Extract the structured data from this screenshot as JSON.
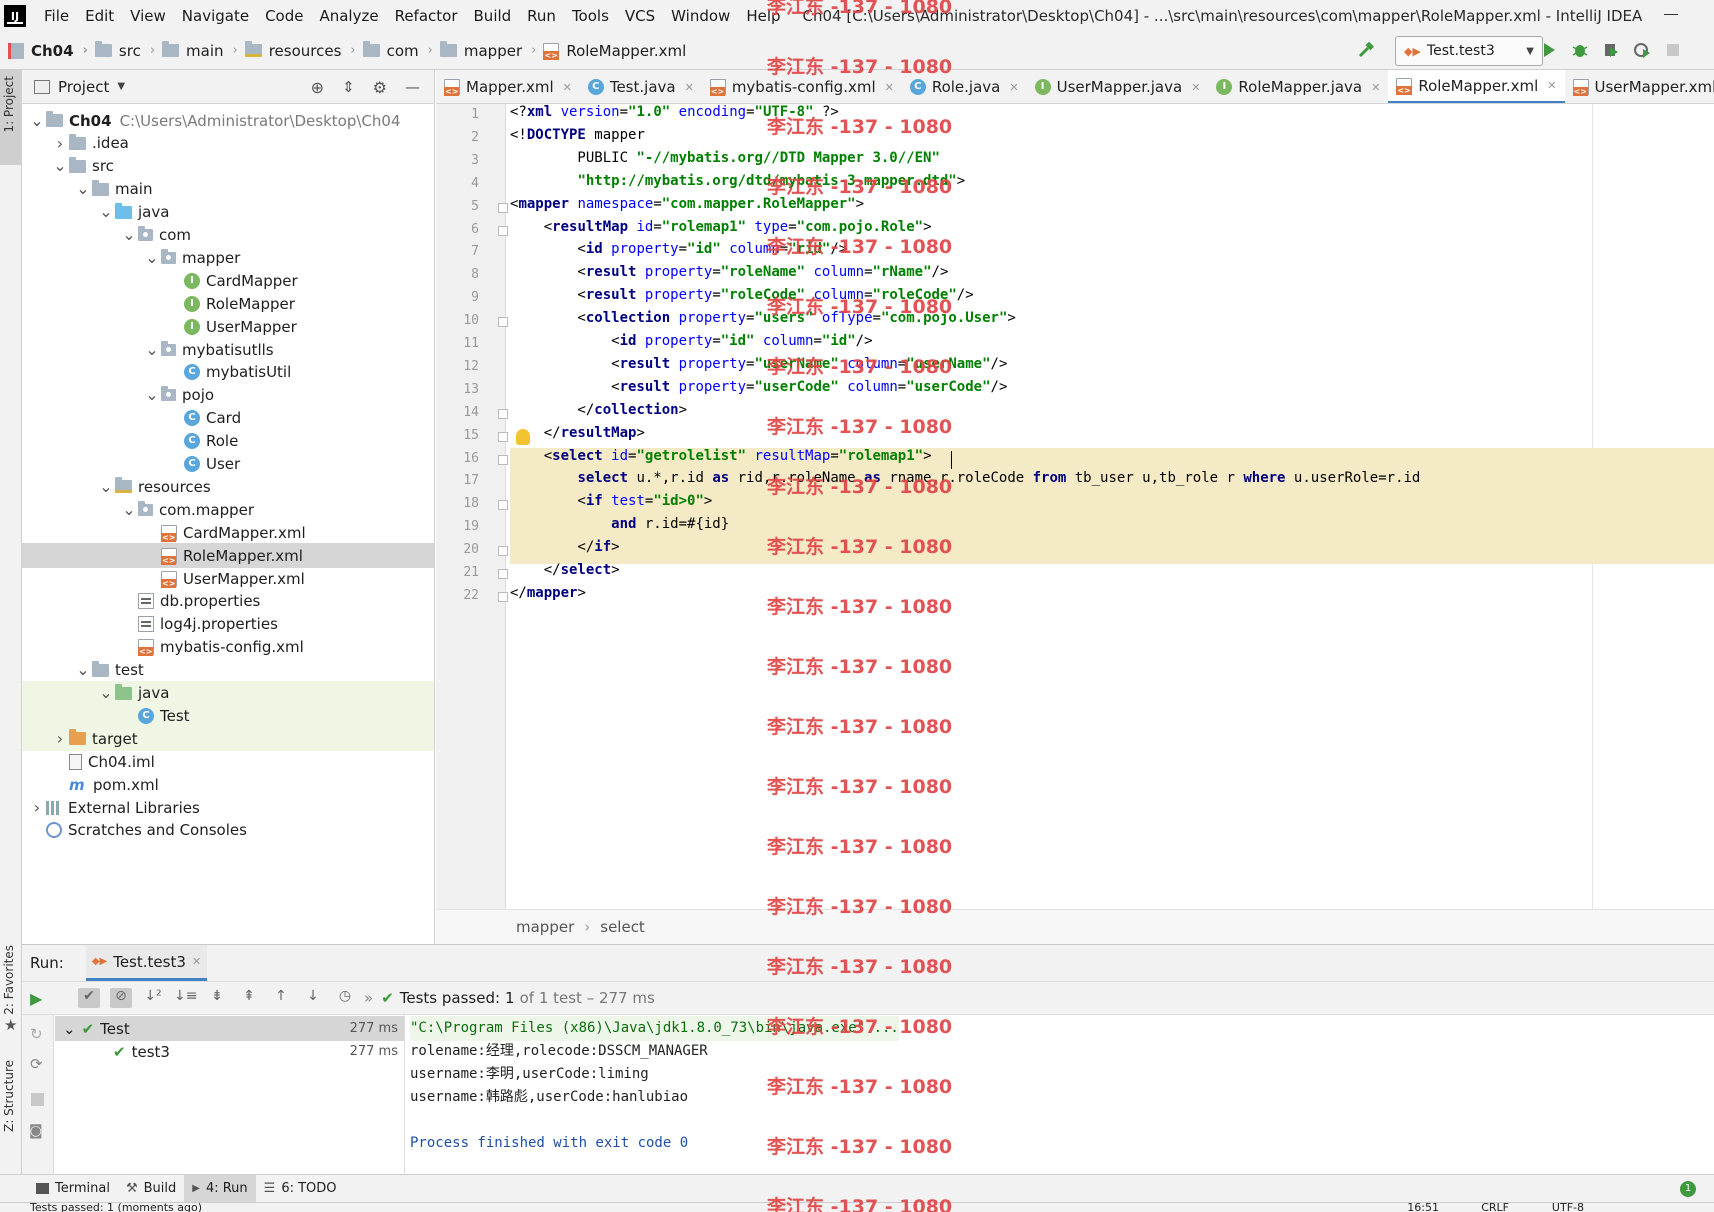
{
  "window": {
    "title": "Ch04 [C:\\Users\\Administrator\\Desktop\\Ch04] - ...\\src\\main\\resources\\com\\mapper\\RoleMapper.xml - IntelliJ IDEA"
  },
  "menu": [
    "File",
    "Edit",
    "View",
    "Navigate",
    "Code",
    "Analyze",
    "Refactor",
    "Build",
    "Run",
    "Tools",
    "VCS",
    "Window",
    "Help"
  ],
  "breadcrumb": [
    "Ch04",
    "src",
    "main",
    "resources",
    "com",
    "mapper",
    "RoleMapper.xml"
  ],
  "run_config": "Test.test3",
  "project_panel": {
    "title": "Project"
  },
  "tree": [
    {
      "label": "Ch04",
      "sub": "C:\\Users\\Administrator\\Desktop\\Ch04",
      "depth": 0,
      "arrow": "v",
      "icon": "folder-icon",
      "bold": true
    },
    {
      "label": ".idea",
      "depth": 1,
      "arrow": ">",
      "icon": "folder-icon"
    },
    {
      "label": "src",
      "depth": 1,
      "arrow": "v",
      "icon": "folder-icon"
    },
    {
      "label": "main",
      "depth": 2,
      "arrow": "v",
      "icon": "folder-icon"
    },
    {
      "label": "java",
      "depth": 3,
      "arrow": "v",
      "icon": "source-folder-icon"
    },
    {
      "label": "com",
      "depth": 4,
      "arrow": "v",
      "icon": "package-icon"
    },
    {
      "label": "mapper",
      "depth": 5,
      "arrow": "v",
      "icon": "package-icon"
    },
    {
      "label": "CardMapper",
      "depth": 6,
      "icon": "interface-icon"
    },
    {
      "label": "RoleMapper",
      "depth": 6,
      "icon": "interface-icon"
    },
    {
      "label": "UserMapper",
      "depth": 6,
      "icon": "interface-icon"
    },
    {
      "label": "mybatisutlls",
      "depth": 5,
      "arrow": "v",
      "icon": "package-icon"
    },
    {
      "label": "mybatisUtil",
      "depth": 6,
      "icon": "class-icon"
    },
    {
      "label": "pojo",
      "depth": 5,
      "arrow": "v",
      "icon": "package-icon"
    },
    {
      "label": "Card",
      "depth": 6,
      "icon": "class-icon"
    },
    {
      "label": "Role",
      "depth": 6,
      "icon": "class-icon"
    },
    {
      "label": "User",
      "depth": 6,
      "icon": "class-icon"
    },
    {
      "label": "resources",
      "depth": 3,
      "arrow": "v",
      "icon": "resources-folder-icon"
    },
    {
      "label": "com.mapper",
      "depth": 4,
      "arrow": "v",
      "icon": "package-icon"
    },
    {
      "label": "CardMapper.xml",
      "depth": 5,
      "icon": "xml-file-icon"
    },
    {
      "label": "RoleMapper.xml",
      "depth": 5,
      "icon": "xml-file-icon",
      "selected": true
    },
    {
      "label": "UserMapper.xml",
      "depth": 5,
      "icon": "xml-file-icon"
    },
    {
      "label": "db.properties",
      "depth": 4,
      "icon": "properties-file-icon"
    },
    {
      "label": "log4j.properties",
      "depth": 4,
      "icon": "properties-file-icon"
    },
    {
      "label": "mybatis-config.xml",
      "depth": 4,
      "icon": "xml-file-icon"
    },
    {
      "label": "test",
      "depth": 2,
      "arrow": "v",
      "icon": "folder-icon"
    },
    {
      "label": "java",
      "depth": 3,
      "arrow": "v",
      "icon": "test-folder-icon",
      "highlight": true
    },
    {
      "label": "Test",
      "depth": 4,
      "icon": "class-icon",
      "highlight": true
    },
    {
      "label": "target",
      "depth": 1,
      "arrow": ">",
      "icon": "excluded-folder-icon",
      "highlight": true
    },
    {
      "label": "Ch04.iml",
      "depth": 1,
      "icon": "iml-file-icon"
    },
    {
      "label": "pom.xml",
      "depth": 1,
      "icon": "maven-icon"
    },
    {
      "label": "External Libraries",
      "depth": 0,
      "arrow": ">",
      "icon": "libraries-icon"
    },
    {
      "label": "Scratches and Consoles",
      "depth": 0,
      "icon": "scratches-icon"
    }
  ],
  "tabs": [
    {
      "label": "Mapper.xml",
      "icon": "xml-file-icon"
    },
    {
      "label": "Test.java",
      "icon": "class-icon"
    },
    {
      "label": "mybatis-config.xml",
      "icon": "xml-file-icon"
    },
    {
      "label": "Role.java",
      "icon": "class-icon"
    },
    {
      "label": "UserMapper.java",
      "icon": "interface-icon"
    },
    {
      "label": "RoleMapper.java",
      "icon": "interface-icon"
    },
    {
      "label": "RoleMapper.xml",
      "icon": "xml-file-icon",
      "active": true
    },
    {
      "label": "UserMapper.xml",
      "icon": "xml-file-icon"
    }
  ],
  "code": [
    "<?xml version=\"1.0\" encoding=\"UTF-8\" ?>",
    "<!DOCTYPE mapper",
    "        PUBLIC \"-//mybatis.org//DTD Mapper 3.0//EN\"",
    "        \"http://mybatis.org/dtd/mybatis-3-mapper.dtd\">",
    "<mapper namespace=\"com.mapper.RoleMapper\">",
    "    <resultMap id=\"rolemap1\" type=\"com.pojo.Role\">",
    "        <id property=\"id\" column=\"rid\"/>",
    "        <result property=\"roleName\" column=\"rName\"/>",
    "        <result property=\"roleCode\" column=\"roleCode\"/>",
    "        <collection property=\"users\" ofType=\"com.pojo.User\">",
    "            <id property=\"id\" column=\"id\"/>",
    "            <result property=\"userName\" column=\"userName\"/>",
    "            <result property=\"userCode\" column=\"userCode\"/>",
    "        </collection>",
    "    </resultMap>",
    "    <select id=\"getrolelist\" resultMap=\"rolemap1\">",
    "        select u.*,r.id as rid,r.roleName as rname,r.roleCode from tb_user u,tb_role r where u.userRole=r.id",
    "        <if test=\"id>0\">",
    "            and r.id=#{id}",
    "        </if>",
    "    </select>",
    "</mapper>"
  ],
  "editor_breadcrumb": [
    "mapper",
    "select"
  ],
  "run": {
    "label": "Run:",
    "tab": "Test.test3",
    "status_prefix": "Tests passed:",
    "status_count": "1",
    "status_suffix": "of 1 test – 277 ms",
    "tests": [
      {
        "name": "Test",
        "time": "277 ms"
      },
      {
        "name": "test3",
        "time": "277 ms"
      }
    ],
    "console": [
      "\"C:\\Program Files (x86)\\Java\\jdk1.8.0_73\\bin\\java.exe\" ...",
      "rolename:经理,rolecode:DSSCM_MANAGER",
      "username:李明,userCode:liming",
      "username:韩路彪,userCode:hanlubiao",
      "",
      "Process finished with exit code 0"
    ]
  },
  "bottom_tabs": [
    "Terminal",
    "Build",
    "4: Run",
    "6: TODO"
  ],
  "side_tabs": {
    "project": "1: Project",
    "favorites": "2: Favorites",
    "structure": "Z: Structure"
  },
  "watermark": "李江东 -137 - 1080",
  "status": {
    "text": "Tests passed: 1 (moments ago)",
    "position": "16:51",
    "line_sep": "CRLF",
    "encoding": "UTF-8"
  }
}
